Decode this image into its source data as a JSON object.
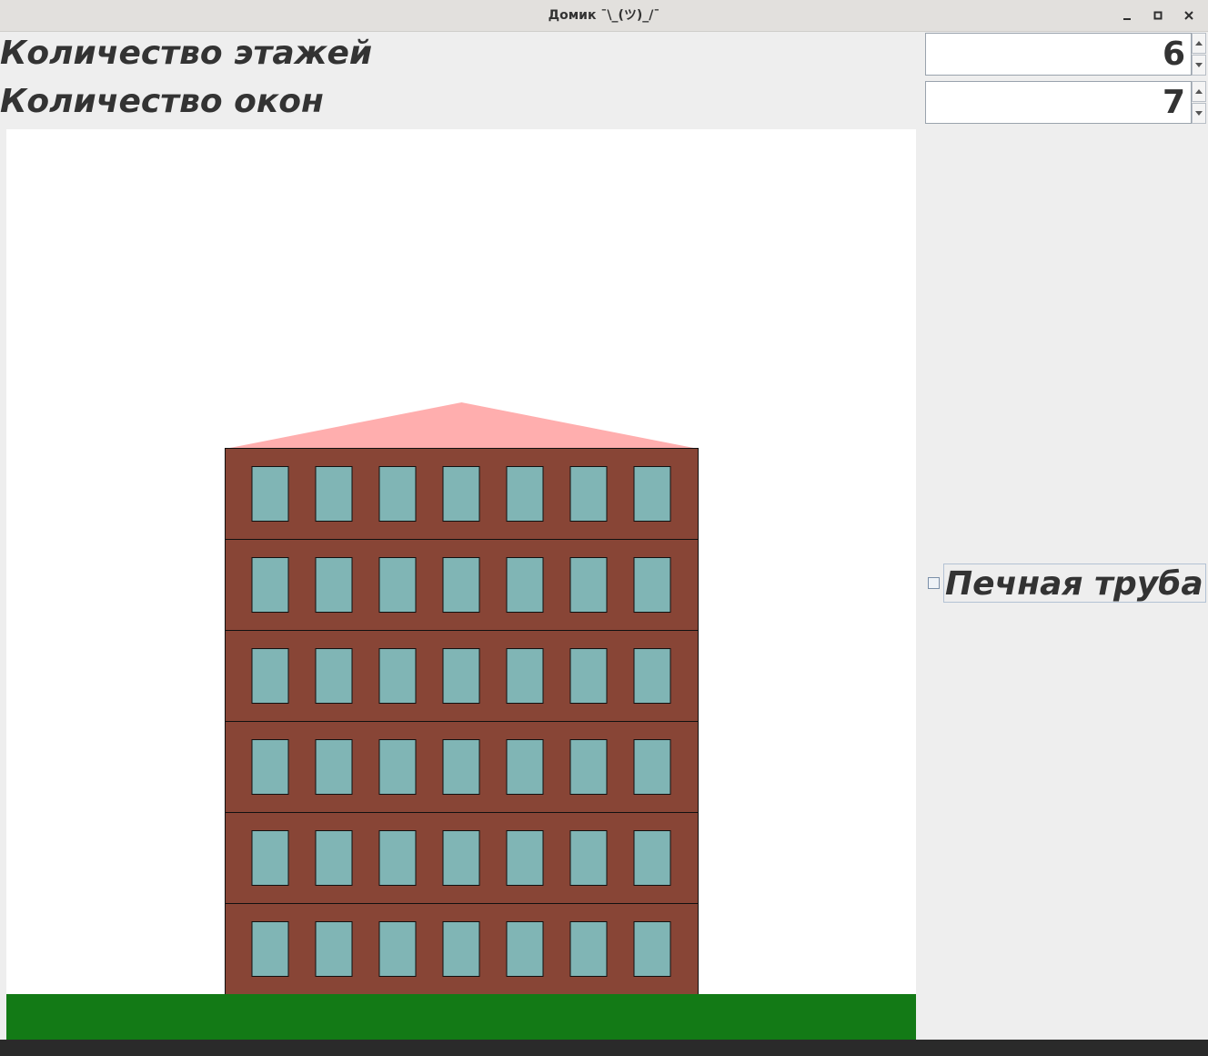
{
  "window": {
    "title": "Домик ¯\\_(ツ)_/¯"
  },
  "controls": {
    "floors_label": "Количество этажей",
    "floors_value": "6",
    "windows_label": "Количество окон",
    "windows_value": "7",
    "chimney_label": "Печная труба",
    "chimney_checked": false
  },
  "scene": {
    "floors": 6,
    "windows_per_floor": 7,
    "colors": {
      "sky": "#ffffff",
      "wall": "#884536",
      "window": "#80b5b5",
      "roof": "#ffaeae",
      "ground": "#137a16",
      "outline": "#111111"
    }
  },
  "icons": {
    "minimize": "minimize-icon",
    "maximize": "maximize-icon",
    "close": "close-icon",
    "spin_up": "arrow-up-icon",
    "spin_down": "arrow-down-icon"
  }
}
